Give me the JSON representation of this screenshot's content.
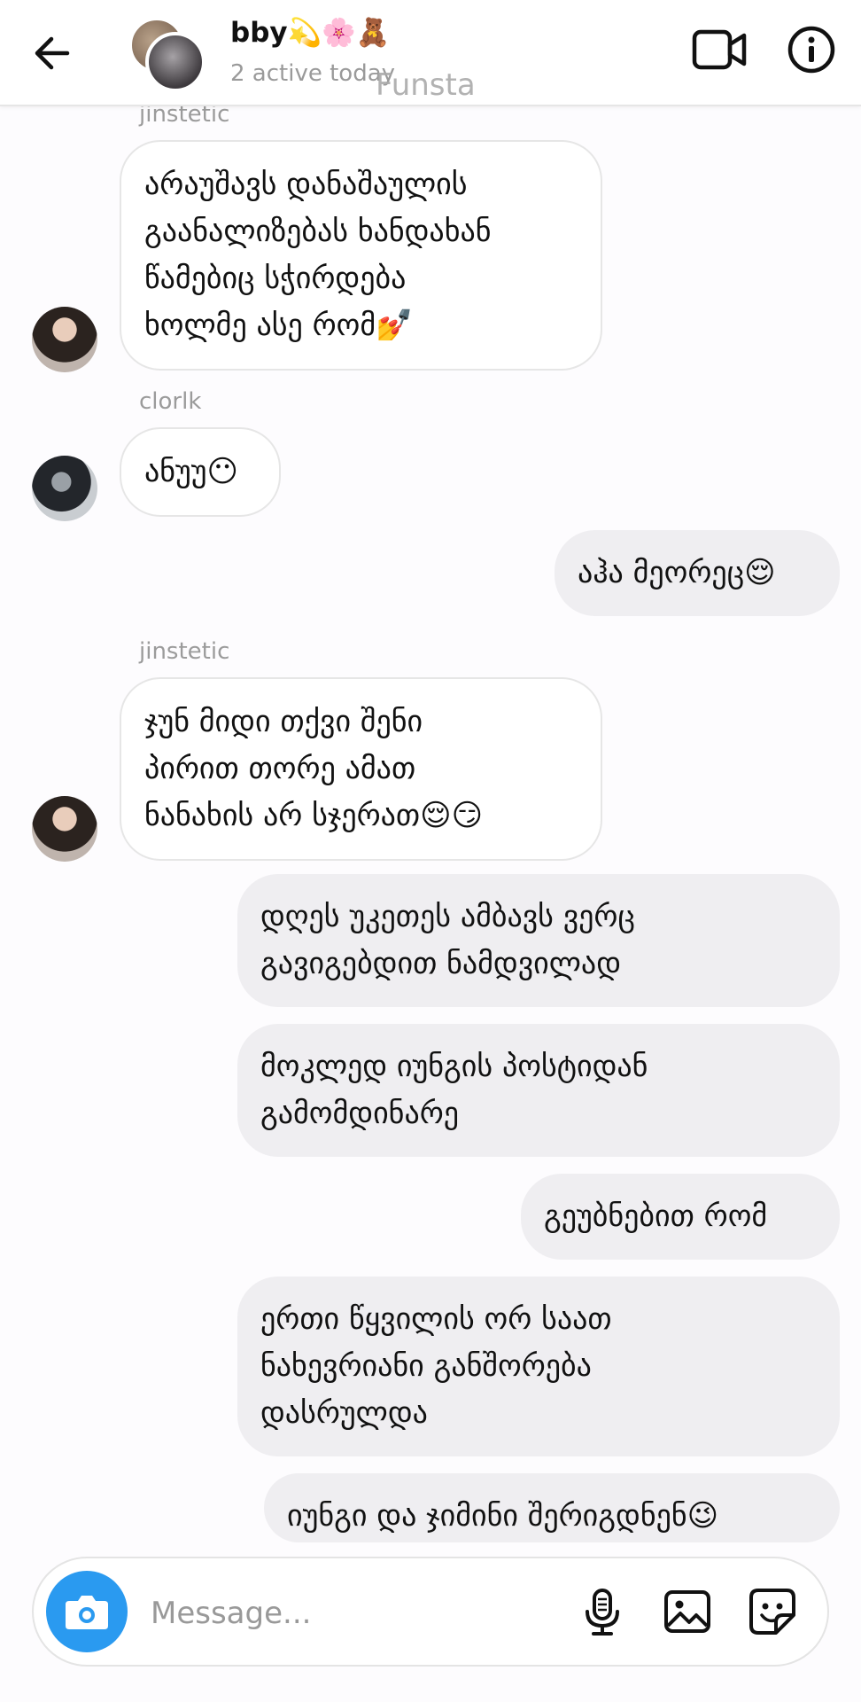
{
  "header": {
    "title": "bby💫🌸🧸",
    "status": "2 active today",
    "watermark": "Funsta"
  },
  "messages": [
    {
      "sender": "jinstetic",
      "direction": "incoming",
      "text": "არაუშავს დანაშაულის\nგაანალიზებას ხანდახან\nწამებიც სჭირდება\nხოლმე ასე რომ💅"
    },
    {
      "sender": "clorlk",
      "direction": "incoming",
      "text": "ანუუ😶"
    },
    {
      "direction": "outgoing",
      "text": "აჰა მეორეც😌"
    },
    {
      "sender": "jinstetic",
      "direction": "incoming",
      "text": "ჯუნ მიდი თქვი შენი\nპირით თორე ამათ\nნანახის არ სჯერათ😌😏"
    },
    {
      "direction": "outgoing",
      "text": "დღეს უკეთეს ამბავს ვერც\nგავიგებდით ნამდვილად"
    },
    {
      "direction": "outgoing",
      "text": "მოკლედ იუნგის პოსტიდან\nგამომდინარე"
    },
    {
      "direction": "outgoing",
      "text": "გეუბნებით რომ"
    },
    {
      "direction": "outgoing",
      "text": "ერთი წყვილის ორ საათ\nნახევრიანი განშორება\nდასრულდა"
    },
    {
      "direction": "outgoing",
      "text": "იუნგი და ჯიმინი შერიგდნენ😉"
    }
  ],
  "composer": {
    "placeholder": "Message..."
  },
  "icons": {
    "back": "arrow-left-icon",
    "video": "video-camera-icon",
    "info": "info-icon",
    "camera": "camera-icon",
    "mic": "microphone-icon",
    "gallery": "image-icon",
    "sticker": "sticker-icon"
  },
  "colors": {
    "accent": "#2a9af0",
    "outgoing_bubble": "#efeef1",
    "incoming_border": "#e6e6e6"
  }
}
